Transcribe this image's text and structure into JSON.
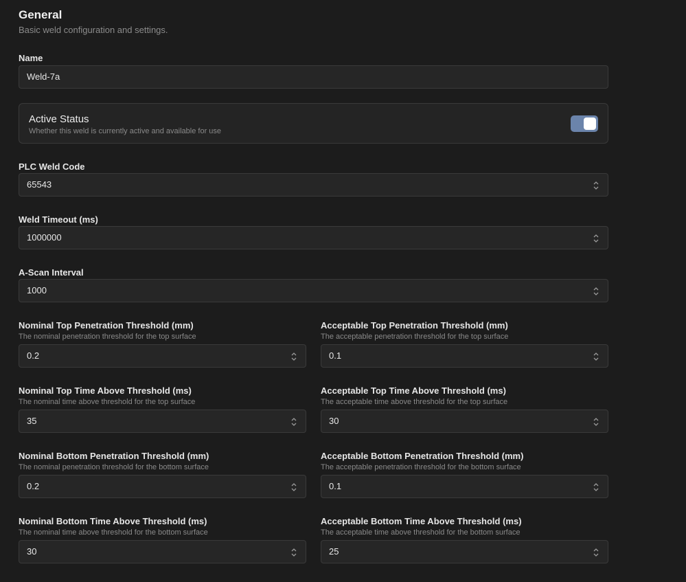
{
  "section": {
    "title": "General",
    "subtitle": "Basic weld configuration and settings."
  },
  "name_field": {
    "label": "Name",
    "value": "Weld-7a"
  },
  "active_status": {
    "title": "Active Status",
    "description": "Whether this weld is currently active and available for use",
    "enabled": true,
    "toggle_color": "#6b84ab"
  },
  "plc_weld_code": {
    "label": "PLC Weld Code",
    "value": "65543"
  },
  "weld_timeout": {
    "label": "Weld Timeout (ms)",
    "value": "1000000"
  },
  "ascan_interval": {
    "label": "A-Scan Interval",
    "value": "1000"
  },
  "nominal_top_pen": {
    "label": "Nominal Top Penetration Threshold (mm)",
    "hint": "The nominal penetration threshold for the top surface",
    "value": "0.2"
  },
  "acceptable_top_pen": {
    "label": "Acceptable Top Penetration Threshold (mm)",
    "hint": "The acceptable penetration threshold for the top surface",
    "value": "0.1"
  },
  "nominal_top_time": {
    "label": "Nominal Top Time Above Threshold (ms)",
    "hint": "The nominal time above threshold for the top surface",
    "value": "35"
  },
  "acceptable_top_time": {
    "label": "Acceptable Top Time Above Threshold (ms)",
    "hint": "The acceptable time above threshold for the top surface",
    "value": "30"
  },
  "nominal_bottom_pen": {
    "label": "Nominal Bottom Penetration Threshold (mm)",
    "hint": "The nominal penetration threshold for the bottom surface",
    "value": "0.2"
  },
  "acceptable_bottom_pen": {
    "label": "Acceptable Bottom Penetration Threshold (mm)",
    "hint": "The acceptable penetration threshold for the bottom surface",
    "value": "0.1"
  },
  "nominal_bottom_time": {
    "label": "Nominal Bottom Time Above Threshold (ms)",
    "hint": "The nominal time above threshold for the bottom surface",
    "value": "30"
  },
  "acceptable_bottom_time": {
    "label": "Acceptable Bottom Time Above Threshold (ms)",
    "hint": "The acceptable time above threshold for the bottom surface",
    "value": "25"
  }
}
